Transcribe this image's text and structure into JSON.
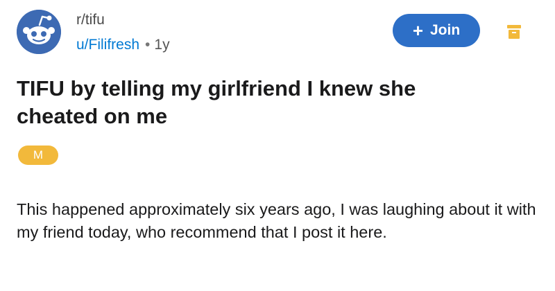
{
  "post": {
    "subreddit": "r/tifu",
    "username": "u/Filifresh",
    "separator": "•",
    "age": "1y",
    "join_label": "Join",
    "join_icon": "plus-icon",
    "title": "TIFU by telling my girlfriend I knew she cheated on me",
    "flair": "M",
    "body": "This happened approximately six years ago, I was laughing about it with my friend today, who recommend that I post it here."
  },
  "colors": {
    "accent": "#2d6fc7",
    "username": "#0079d3",
    "flair": "#f2b93b",
    "avatar": "#3d6ab3",
    "archive": "#f2b93b"
  },
  "icons": {
    "avatar": "reddit-snoo-avatar",
    "archive": "archive-icon"
  }
}
